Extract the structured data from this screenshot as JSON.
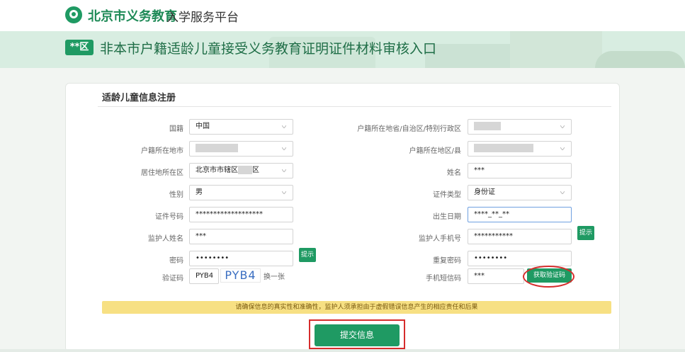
{
  "header": {
    "brand": "北京市义务教育",
    "brand_sub": "入学服务平台"
  },
  "banner": {
    "district_badge": "**区",
    "title": "非本市户籍适龄儿童接受义务教育证明证件材料审核入口"
  },
  "form": {
    "title": "适龄儿童信息注册",
    "left": {
      "nationality": {
        "label": "国籍",
        "value": "中国"
      },
      "household_city": {
        "label": "户籍所在地市",
        "value": ""
      },
      "residence_district": {
        "label": "居住地所在区",
        "value_prefix": "北京市市辖区",
        "value_suffix": "区"
      },
      "gender": {
        "label": "性别",
        "value": "男"
      },
      "id_number": {
        "label": "证件号码",
        "value": "*******************"
      },
      "guardian_name": {
        "label": "监护人姓名",
        "value": "***"
      },
      "password": {
        "label": "密码",
        "value": "••••••••"
      },
      "captcha": {
        "label": "验证码",
        "value": "PYB4",
        "image_text": "PYB4",
        "refresh_label": "换一张"
      }
    },
    "right": {
      "household_province": {
        "label": "户籍所在地省/自治区/特别行政区",
        "value": ""
      },
      "household_county": {
        "label": "户籍所在地区/县",
        "value": ""
      },
      "name": {
        "label": "姓名",
        "value": "***"
      },
      "id_type": {
        "label": "证件类型",
        "value": "身份证"
      },
      "birth_date": {
        "label": "出生日期",
        "value": "****_**_**"
      },
      "guardian_phone": {
        "label": "监护人手机号",
        "value": "***********"
      },
      "confirm_password": {
        "label": "重复密码",
        "value": "••••••••"
      },
      "sms_code": {
        "label": "手机短信码",
        "value": "***",
        "button": "获取验证码"
      }
    },
    "tip_label": "提示",
    "notice": "请确保信息的真实性和准确性，监护人须承担由于虚假错误信息产生的相应责任和后果",
    "submit": "提交信息"
  },
  "colors": {
    "primary_green": "#1f9a63",
    "highlight_red": "#d62c2c",
    "notice_yellow": "#f7e083"
  }
}
